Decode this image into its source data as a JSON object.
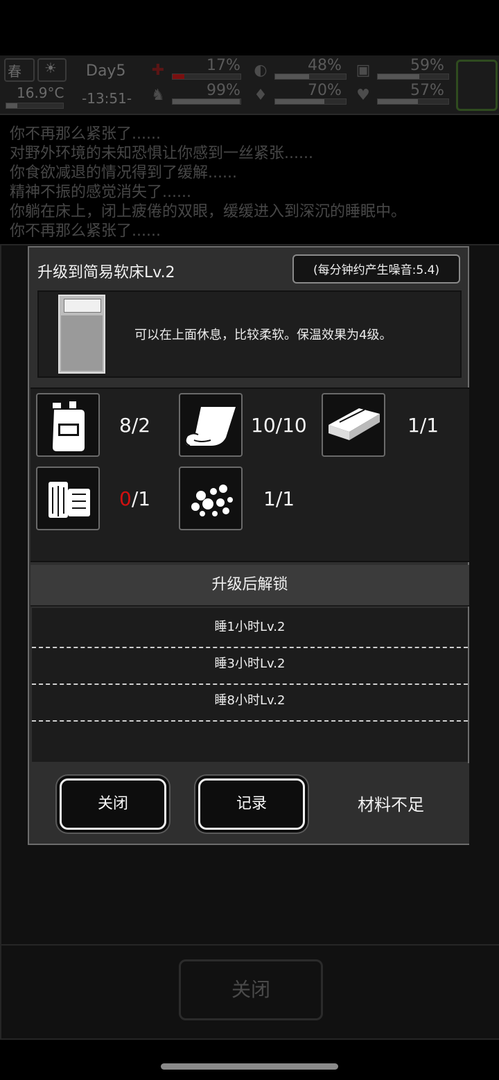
{
  "hud": {
    "season": "春",
    "temperature": "16.9°C",
    "day": "Day5",
    "time": "-13:51-",
    "stats": [
      {
        "name": "health-bag",
        "value": "17%",
        "fill": 0.17
      },
      {
        "name": "hunger",
        "value": "48%",
        "fill": 0.48
      },
      {
        "name": "energy",
        "value": "59%",
        "fill": 0.59
      },
      {
        "name": "stamina",
        "value": "99%",
        "fill": 0.99
      },
      {
        "name": "thirst",
        "value": "70%",
        "fill": 0.7
      },
      {
        "name": "mood",
        "value": "57%",
        "fill": 0.57
      }
    ]
  },
  "log": [
    "你不再那么紧张了......",
    "对野外环境的未知恐惧让你感到一丝紧张......",
    "你食欲减退的情况得到了缓解......",
    "精神不振的感觉消失了......",
    "你躺在床上，闭上疲倦的双眼，缓缓进入到深沉的睡眠中。",
    "你不再那么紧张了......"
  ],
  "background": {
    "close_label": "关闭"
  },
  "dialog": {
    "title": "升级到简易软床Lv.2",
    "noise": "(每分钟约产生噪音:5.4)",
    "description": "可以在上面休息，比较柔软。保温效果为4级。",
    "materials": [
      {
        "icon": "fuel-can-icon",
        "have": "8",
        "need": "/2",
        "sufficient": true
      },
      {
        "icon": "cloth-icon",
        "have": "10",
        "need": "/10",
        "sufficient": true
      },
      {
        "icon": "plank-icon",
        "have": "1",
        "need": "/1",
        "sufficient": true
      },
      {
        "icon": "wood-logs-icon",
        "have": "0",
        "need": "/1",
        "sufficient": false
      },
      {
        "icon": "stones-icon",
        "have": "1",
        "need": "/1",
        "sufficient": true
      }
    ],
    "unlock_header": "升级后解锁",
    "unlocks": [
      "睡1小时Lv.2",
      "睡3小时Lv.2",
      "睡8小时Lv.2"
    ],
    "close_label": "关闭",
    "record_label": "记录",
    "status": "材料不足",
    "short_color": "#d01010"
  }
}
